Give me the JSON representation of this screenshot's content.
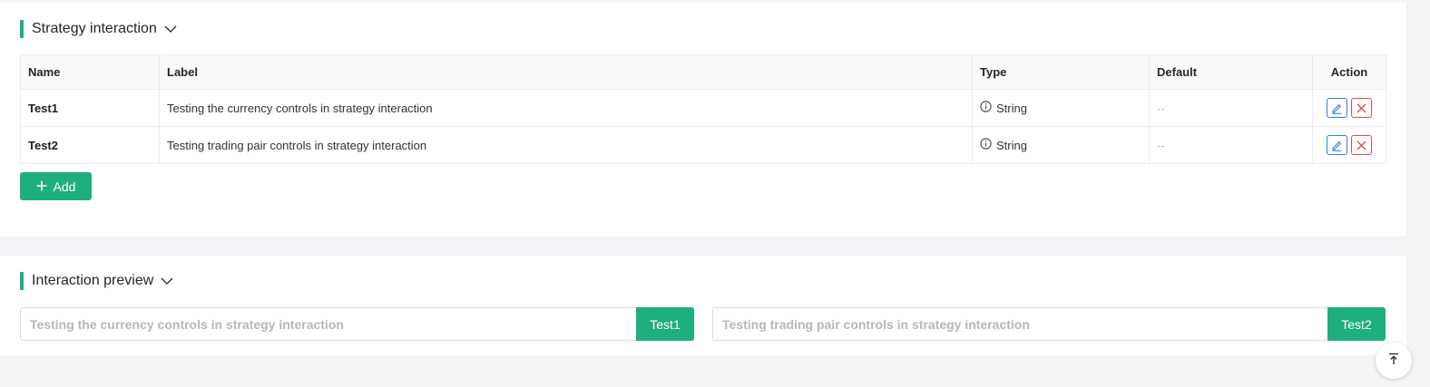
{
  "colors": {
    "accent": "#1fae7e",
    "edit": "#2f7fe0",
    "delete": "#e5484d"
  },
  "strategy_section": {
    "title": "Strategy interaction",
    "columns": {
      "name": "Name",
      "label": "Label",
      "type": "Type",
      "default": "Default",
      "action": "Action"
    },
    "rows": [
      {
        "name": "Test1",
        "label": "Testing the currency controls in strategy interaction",
        "type": "String",
        "default": "--"
      },
      {
        "name": "Test2",
        "label": "Testing trading pair controls in strategy interaction",
        "type": "String",
        "default": "--"
      }
    ],
    "add_label": "Add"
  },
  "preview_section": {
    "title": "Interaction preview",
    "fields": [
      {
        "placeholder": "Testing the currency controls in strategy interaction",
        "addon": "Test1"
      },
      {
        "placeholder": "Testing trading pair controls in strategy interaction",
        "addon": "Test2"
      }
    ]
  },
  "icons": {
    "collapse": "chevron-down-icon",
    "info": "info-circle-icon",
    "edit": "pencil-icon",
    "delete": "close-icon",
    "add": "plus-icon",
    "back_to_top": "arrow-up-to-line-icon"
  }
}
